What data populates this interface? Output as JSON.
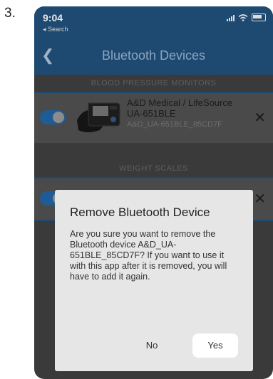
{
  "step_number": "3.",
  "status_bar": {
    "time": "9:04",
    "back_app": "◂ Search"
  },
  "nav": {
    "back_icon": "chevron-left-icon",
    "title": "Bluetooth Devices"
  },
  "sections": [
    {
      "header": "BLOOD PRESSURE MONITORS",
      "devices": [
        {
          "name": "A&D Medical / LifeSource UA-651BLE",
          "id": "A&D_UA-651BLE_85CD7F",
          "enabled": true
        }
      ]
    },
    {
      "header": "WEIGHT SCALES",
      "devices": [
        {
          "enabled": true
        }
      ]
    }
  ],
  "dialog": {
    "title": "Remove Bluetooth Device",
    "message": "Are you sure you want to remove the Bluetooth device A&D_UA-651BLE_85CD7F? If you want to use it with this app after it is removed, you will have to add it again.",
    "no_label": "No",
    "yes_label": "Yes"
  },
  "colors": {
    "nav": "#1e4a72",
    "toggle": "#1f5c96",
    "dialog": "#e6e6e6"
  }
}
